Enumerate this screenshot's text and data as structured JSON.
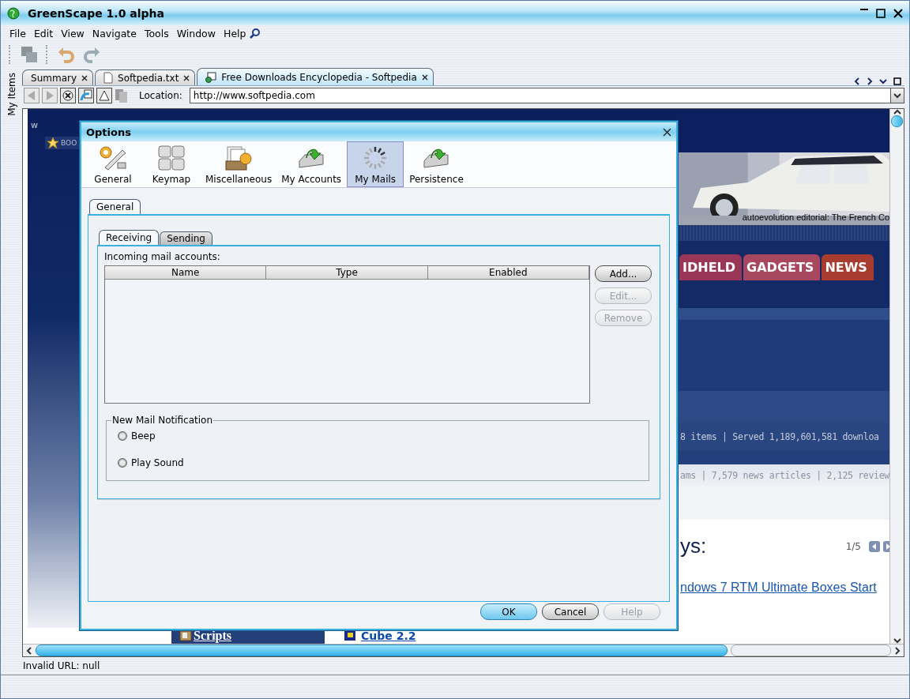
{
  "window": {
    "title": "GreenScape 1.0 alpha"
  },
  "menu": [
    "File",
    "Edit",
    "View",
    "Navigate",
    "Tools",
    "Window",
    "Help"
  ],
  "side_panel": {
    "label": "My Items"
  },
  "tabs": [
    {
      "label": "Summary",
      "kind": "plain",
      "selected": false
    },
    {
      "label": "Softpedia.txt",
      "kind": "file",
      "selected": false
    },
    {
      "label": "Free Downloads Encyclopedia - Softpedia",
      "kind": "web",
      "selected": true
    }
  ],
  "navigation": {
    "location_label": "Location:",
    "url": "http://www.softpedia.com"
  },
  "web_page": {
    "header_text": "w",
    "bookmark": "BOO",
    "picture_caption": "autoevolution editorial: The French Co",
    "nav_tabs": [
      {
        "label": "IDHELD",
        "color": "#9a3658"
      },
      {
        "label": "GADGETS",
        "color": "#a8485e"
      },
      {
        "label": "NEWS",
        "color": "#a83c30"
      }
    ],
    "stats": [
      "8 items | Served 1,189,601,581 downloa",
      "ams | 7,579 news articles | 2,125 review"
    ],
    "heading": "ys:",
    "pager": "1/5",
    "headline_link": "ndows 7 RTM Ultimate Boxes Start",
    "category": "Scripts",
    "download_link": "Cube 2.2"
  },
  "dialog": {
    "title": "Options",
    "categories": [
      {
        "label": "General",
        "selected": false
      },
      {
        "label": "Keymap",
        "selected": false
      },
      {
        "label": "Miscellaneous",
        "selected": false
      },
      {
        "label": "My Accounts",
        "selected": false
      },
      {
        "label": "My Mails",
        "selected": true
      },
      {
        "label": "Persistence",
        "selected": false
      }
    ],
    "tabs": [
      {
        "label": "General",
        "selected": true
      }
    ],
    "subtabs": [
      {
        "label": "Receiving",
        "selected": true
      },
      {
        "label": "Sending",
        "selected": false
      }
    ],
    "accounts_label": "Incoming mail accounts:",
    "table": {
      "columns": [
        "Name",
        "Type",
        "Enabled"
      ]
    },
    "side_buttons": [
      {
        "label": "Add...",
        "disabled": false
      },
      {
        "label": "Edit...",
        "disabled": true
      },
      {
        "label": "Remove",
        "disabled": true
      }
    ],
    "notification": {
      "title": "New Mail Notification",
      "options": [
        {
          "label": "Beep",
          "selected": false
        },
        {
          "label": "Play Sound",
          "selected": false
        }
      ]
    },
    "buttons": [
      {
        "label": "OK",
        "disabled": false,
        "primary": true
      },
      {
        "label": "Cancel",
        "disabled": false,
        "primary": false
      },
      {
        "label": "Help",
        "disabled": true,
        "primary": false
      }
    ]
  },
  "status_bar": "Invalid URL: null"
}
